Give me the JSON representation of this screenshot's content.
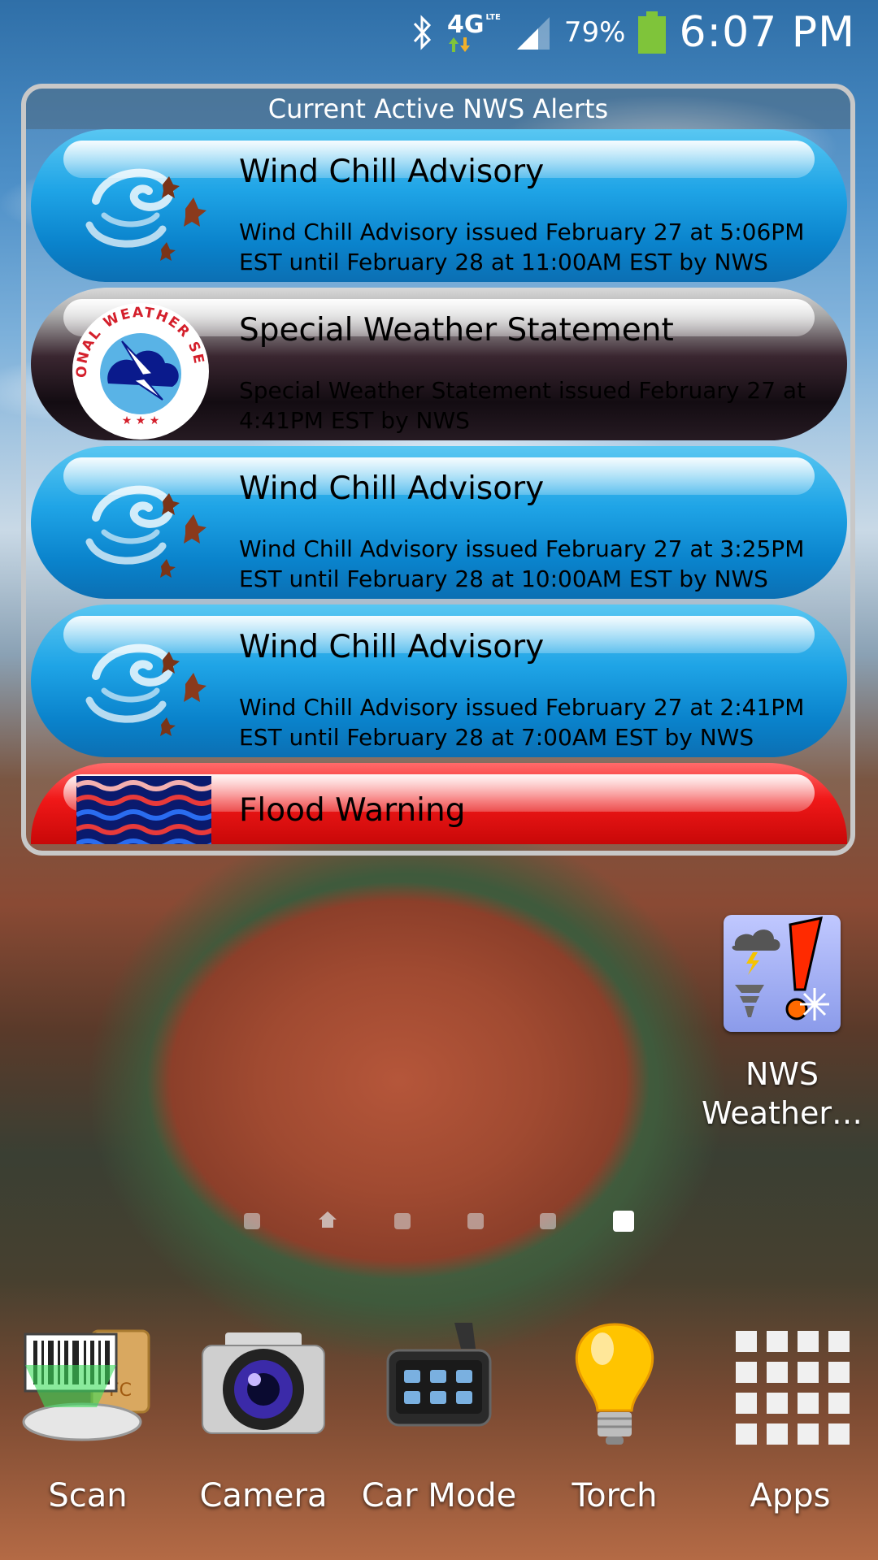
{
  "status_bar": {
    "network": "4G",
    "network_sub": "LTE",
    "battery": "79%",
    "time": "6:07 PM"
  },
  "widget": {
    "header": "Current Active NWS Alerts",
    "alerts": [
      {
        "title": "Wind Chill Advisory",
        "desc": "Wind Chill Advisory issued February 27 at 5:06PM EST until February 28 at 11:00AM EST by NWS",
        "icon": "wind-chill-icon"
      },
      {
        "title": "Special Weather Statement",
        "desc": "Special Weather Statement issued February 27 at 4:41PM EST by NWS",
        "icon": "nws-logo-icon",
        "logo_text": "NATIONAL WEATHER SERVICE"
      },
      {
        "title": "Wind Chill Advisory",
        "desc": "Wind Chill Advisory issued February 27 at 3:25PM EST until February 28 at 10:00AM EST by NWS",
        "icon": "wind-chill-icon"
      },
      {
        "title": "Wind Chill Advisory",
        "desc": "Wind Chill Advisory issued February 27 at 2:41PM EST until February 28 at 7:00AM EST by NWS",
        "icon": "wind-chill-icon"
      },
      {
        "title": "Flood Warning",
        "icon": "flood-icon"
      }
    ]
  },
  "desktop_app": {
    "label_line1": "NWS",
    "label_line2": "Weather…",
    "icon": "nws-weather-app-icon"
  },
  "pager": {
    "pages": 6,
    "home_index": 1,
    "active_index": 5
  },
  "dock": [
    {
      "label": "Scan",
      "icon": "barcode-scan-icon"
    },
    {
      "label": "Camera",
      "icon": "camera-icon"
    },
    {
      "label": "Car Mode",
      "icon": "car-mode-icon"
    },
    {
      "label": "Torch",
      "icon": "lightbulb-icon"
    },
    {
      "label": "Apps",
      "icon": "apps-grid-icon"
    }
  ],
  "colors": {
    "alert_blue": "#1fa4e6",
    "alert_red": "#f01818",
    "battery_green": "#7fc43a"
  }
}
